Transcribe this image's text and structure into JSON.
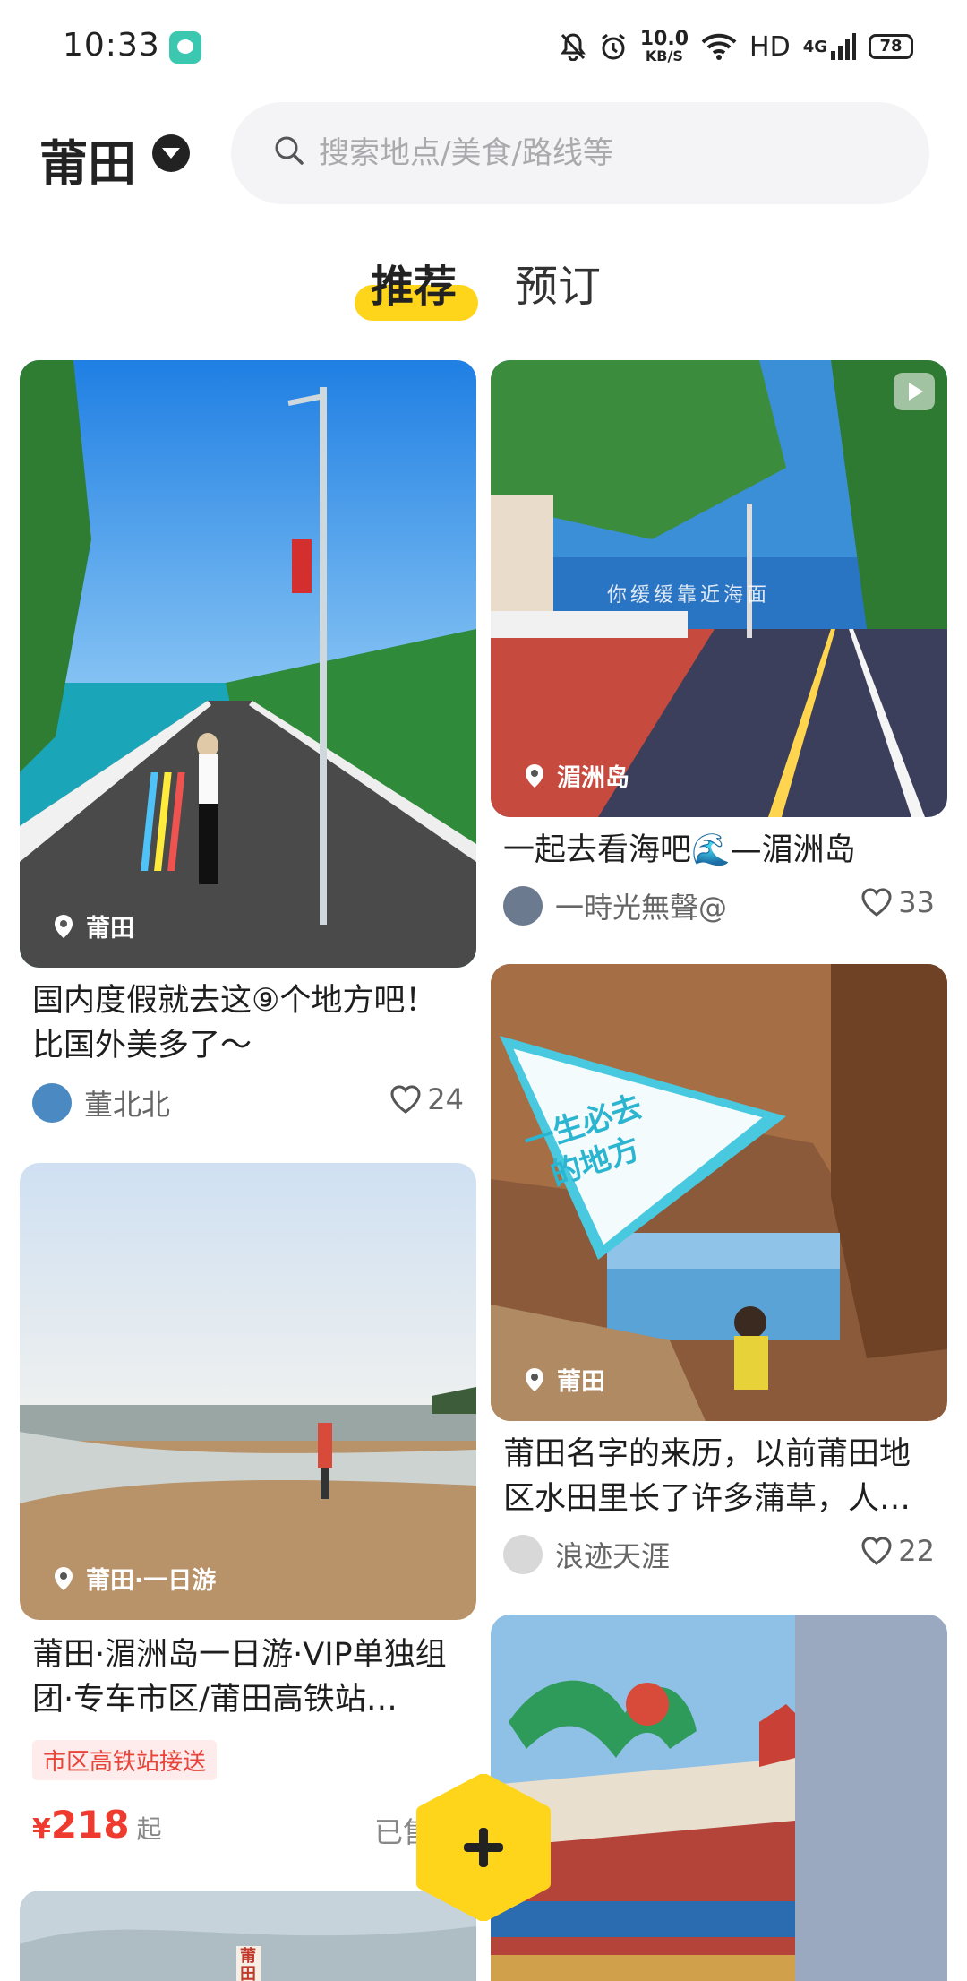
{
  "status_bar": {
    "time": "10:33",
    "net_speed_value": "10.0",
    "net_speed_unit": "KB/S",
    "hd": "HD",
    "network": "4G",
    "battery": "78"
  },
  "header": {
    "city": "莆田",
    "search_placeholder": "搜索地点/美食/路线等"
  },
  "tabs": [
    {
      "label": "推荐",
      "active": true
    },
    {
      "label": "预订",
      "active": false
    }
  ],
  "cards": [
    {
      "location": "莆田",
      "title": "国内度假就去这⑨个地方吧！比国外美多了～",
      "author": "董北北",
      "likes": "24"
    },
    {
      "location": "湄洲岛",
      "title": "一起去看海吧🌊—湄洲岛",
      "author": "一時光無聲@",
      "likes": "33",
      "video": true,
      "overlay_text": "你缓缓靠近海面"
    },
    {
      "location": "莆田",
      "title": "莆田名字的来历，以前莆田地区水田里长了许多蒲草，人…",
      "author": "浪迹天涯",
      "likes": "22",
      "sticker_text_line1": "一生必去",
      "sticker_text_line2": "的地方"
    },
    {
      "location": "莆田·一日游",
      "title": "莆田·湄洲岛一日游·VIP单独组团·专车市区/莆田高铁站…",
      "badge": "市区高铁站接送",
      "price_symbol": "¥",
      "price_value": "218",
      "price_suffix": "起",
      "sold": "已售"
    },
    {
      "sign_text": "莆田"
    }
  ],
  "colors": {
    "accent_yellow": "#ffd51c",
    "price_red": "#ef3b2f",
    "badge_bg": "#fdeceb"
  }
}
